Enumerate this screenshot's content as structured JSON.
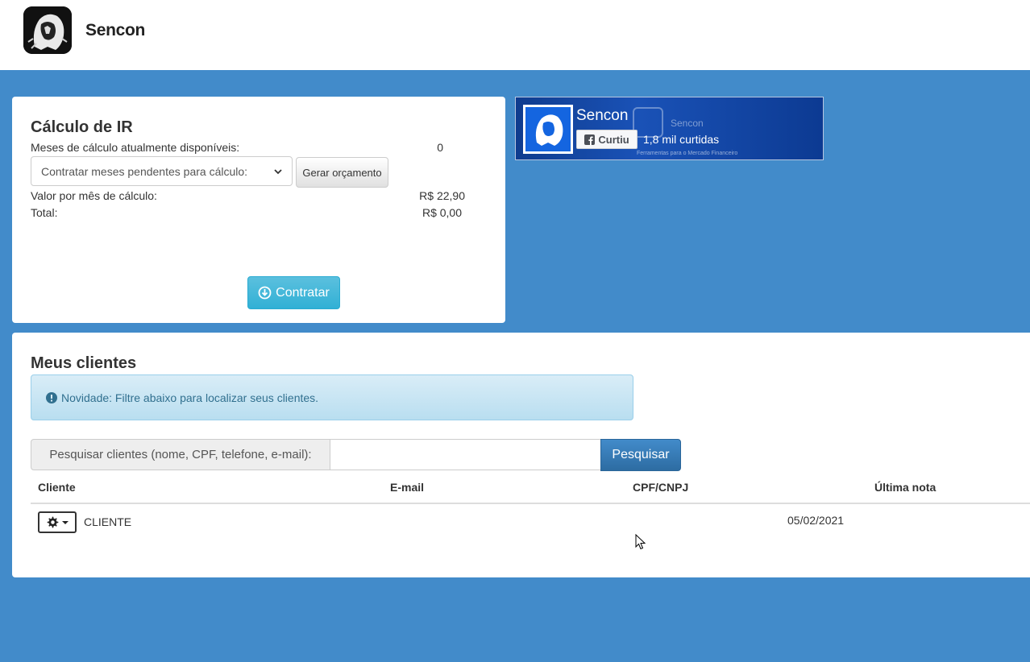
{
  "header": {
    "brand": "Sencon",
    "logo_icon": "lion-logo-icon"
  },
  "ir_panel": {
    "title": "Cálculo de IR",
    "months_label": "Meses de cálculo atualmente disponíveis:",
    "months_value": "0",
    "select_value": "Contratar meses pendentes para cálculo:",
    "budget_button": "Gerar orçamento",
    "price_label": "Valor por mês de cálculo:",
    "price_value": "R$ 22,90",
    "total_label": "Total:",
    "total_value": "R$ 0,00",
    "contract_button": "Contratar",
    "contract_icon": "download-circle-icon"
  },
  "facebook_widget": {
    "page_name": "Sencon",
    "like_button": "Curtiu",
    "likes_count": "1,8 mil curtidas",
    "cover_name": "Sencon",
    "cover_tagline": "Ferramentas para o Mercado Financeiro"
  },
  "clients_panel": {
    "title": "Meus clientes",
    "alert_text": "Novidade: Filtre abaixo para localizar seus clientes.",
    "alert_icon": "exclamation-circle-icon",
    "search_label": "Pesquisar clientes (nome, CPF, telefone, e-mail):",
    "search_value": "",
    "search_button": "Pesquisar",
    "columns": [
      "Cliente",
      "E-mail",
      "CPF/CNPJ",
      "Última nota"
    ],
    "rows": [
      {
        "cliente": "CLIENTE",
        "email": "",
        "cpf_cnpj": "",
        "ultima_nota": "05/02/2021"
      }
    ]
  },
  "colors": {
    "background": "#428bca",
    "info_button": "#5bc0de",
    "primary_button": "#337ab7"
  }
}
